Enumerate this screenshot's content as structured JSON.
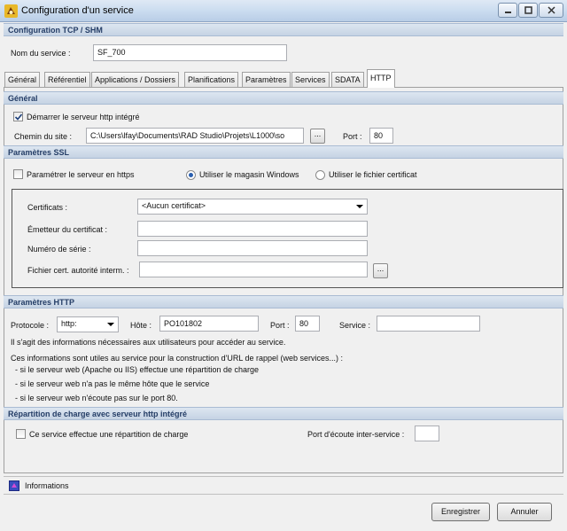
{
  "window": {
    "title": "Configuration d'un service"
  },
  "tcp_section": {
    "header": "Configuration TCP / SHM",
    "service_name_label": "Nom du service :",
    "service_name_value": "SF_700"
  },
  "tabs": [
    "Général",
    "Référentiel",
    "Applications / Dossiers",
    "Planifications",
    "Paramètres",
    "Services",
    "SDATA",
    "HTTP"
  ],
  "general": {
    "header": "Général",
    "start_server_label": "Démarrer le serveur http intégré",
    "site_path_label": "Chemin du site :",
    "site_path_value": "C:\\Users\\lfay\\Documents\\RAD Studio\\Projets\\L1000\\so",
    "browse_label": "...",
    "port_label": "Port :",
    "port_value": "80"
  },
  "ssl": {
    "header": "Paramètres SSL",
    "https_label": "Paramétrer le serveur en https",
    "radio_windows_label": "Utiliser le magasin Windows",
    "radio_file_label": "Utiliser le fichier certificat",
    "certificates_label": "Certificats :",
    "certificates_value": "<Aucun certificat>",
    "issuer_label": "Émetteur du certificat :",
    "serial_label": "Numéro de série :",
    "authority_label": "Fichier cert. autorité interm. :",
    "browse_label": "..."
  },
  "http": {
    "header": "Paramètres HTTP",
    "protocol_label": "Protocole :",
    "protocol_value": "http:",
    "host_label": "Hôte :",
    "host_value": "PO101802",
    "port_label": "Port :",
    "port_value": "80",
    "service_label": "Service :",
    "service_value": "",
    "info_line": "Il s'agit des informations nécessaires aux utilisateurs pour accéder au service.",
    "usage_line": "Ces informations sont utiles au service pour la construction d'URL de rappel (web services...) :",
    "bullets": [
      "- si le serveur web (Apache ou IIS) effectue une répartition de charge",
      "- si le serveur web n'a pas le même hôte que le service",
      "- si le serveur web n'écoute pas sur le port 80."
    ]
  },
  "load_balancing": {
    "header": "Répartition de charge avec serveur http intégré",
    "checkbox_label": "Ce service effectue une répartition de charge",
    "inter_port_label": "Port d'écoute inter-service :",
    "inter_port_value": ""
  },
  "footer": {
    "info_label": "Informations",
    "save_label": "Enregistrer",
    "cancel_label": "Annuler"
  },
  "colors": {
    "section_text": "#243d66",
    "check_mark": "#1d3f7a"
  }
}
